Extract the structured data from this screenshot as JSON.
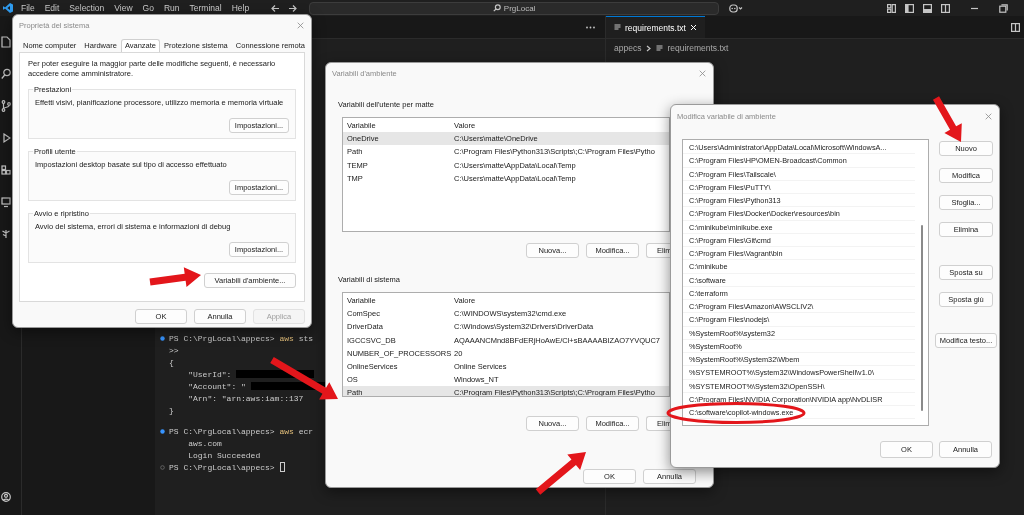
{
  "vscode": {
    "menu": [
      "File",
      "Edit",
      "Selection",
      "View",
      "Go",
      "Run",
      "Terminal",
      "Help"
    ],
    "search": {
      "value": "PrgLocal"
    },
    "editor_tab": {
      "label": "requirements.txt"
    },
    "breadcrumb": [
      "appecs",
      "requirements.txt"
    ],
    "terminal": {
      "lines": [
        {
          "kind": "prompt",
          "succeeded": true,
          "prompt": "PS C:\\PrgLocal\\appecs>",
          "command": "aws",
          "args": "sts",
          "cursor": false
        },
        {
          "kind": "output",
          "text": ">>"
        },
        {
          "kind": "output",
          "text": "{"
        },
        {
          "kind": "redacted",
          "text": "\"UserId\":"
        },
        {
          "kind": "redacted",
          "text": "\"Account\": \""
        },
        {
          "kind": "output",
          "text": "\"Arn\": \"arn:aws:iam::137"
        },
        {
          "kind": "output",
          "text": "}"
        },
        {
          "kind": "blank"
        },
        {
          "kind": "prompt",
          "succeeded": true,
          "prompt": "PS C:\\PrgLocal\\appecs>",
          "command": "aws",
          "args": "ecr",
          "cursor": false
        },
        {
          "kind": "output",
          "text": "aws.com"
        },
        {
          "kind": "output",
          "text": "Login Succeeded"
        },
        {
          "kind": "prompt",
          "succeeded": false,
          "prompt": "PS C:\\PrgLocal\\appecs>",
          "cursor": true
        }
      ]
    }
  },
  "system_properties": {
    "title": "Proprietà del sistema",
    "tabs": [
      {
        "label": "Nome computer",
        "selected": false
      },
      {
        "label": "Hardware",
        "selected": false
      },
      {
        "label": "Avanzate",
        "selected": true
      },
      {
        "label": "Protezione sistema",
        "selected": false
      },
      {
        "label": "Connessione remota",
        "selected": false
      }
    ],
    "intro": "Per poter eseguire la maggior parte delle modifiche seguenti, è necessario accedere come amministratore.",
    "groups": [
      {
        "title": "Prestazioni",
        "text": "Effetti visivi, pianificazione processore, utilizzo memoria e memoria virtuale",
        "button": "Impostazioni..."
      },
      {
        "title": "Profili utente",
        "text": "Impostazioni desktop basate sul tipo di accesso effettuato",
        "button": "Impostazioni..."
      },
      {
        "title": "Avvio e ripristino",
        "text": "Avvio del sistema, errori di sistema e informazioni di debug",
        "button": "Impostazioni..."
      }
    ],
    "env_button": "Variabili d'ambiente...",
    "buttons": [
      {
        "label": "OK",
        "disabled": false
      },
      {
        "label": "Annulla",
        "disabled": false
      },
      {
        "label": "Applica",
        "disabled": true
      }
    ]
  },
  "environment_variables": {
    "title": "Variabili d'ambiente",
    "sections": [
      {
        "title": "Variabili dell'utente per matte",
        "columns": [
          "Variabile",
          "Valore"
        ],
        "rows": [
          {
            "name": "OneDrive",
            "value": "C:\\Users\\matte\\OneDrive",
            "selected": true
          },
          {
            "name": "Path",
            "value": "C:\\Program Files\\Python313\\Scripts\\;C:\\Program Files\\Pytho",
            "selected": false
          },
          {
            "name": "TEMP",
            "value": "C:\\Users\\matte\\AppData\\Local\\Temp",
            "selected": false
          },
          {
            "name": "TMP",
            "value": "C:\\Users\\matte\\AppData\\Local\\Temp",
            "selected": false
          }
        ],
        "buttons": [
          "Nuova...",
          "Modifica...",
          "Elim"
        ]
      },
      {
        "title": "Variabili di sistema",
        "columns": [
          "Variabile",
          "Valore"
        ],
        "rows": [
          {
            "name": "ComSpec",
            "value": "C:\\WINDOWS\\system32\\cmd.exe",
            "selected": false
          },
          {
            "name": "DriverData",
            "value": "C:\\Windows\\System32\\Drivers\\DriverData",
            "selected": false
          },
          {
            "name": "IGCCSVC_DB",
            "value": "AQAAANCMnd8BFdERjHoAwE/Cl+sBAAAABIZAO7YVQUC7",
            "selected": false
          },
          {
            "name": "NUMBER_OF_PROCESSORS",
            "value": "20",
            "selected": false
          },
          {
            "name": "OnlineServices",
            "value": "Online Services",
            "selected": false
          },
          {
            "name": "OS",
            "value": "Windows_NT",
            "selected": false
          },
          {
            "name": "Path",
            "value": "C:\\Program Files\\Python313\\Scripts\\;C:\\Program Files\\Pytho",
            "selected": true
          }
        ],
        "buttons": [
          "Nuova...",
          "Modifica...",
          "Elim"
        ]
      }
    ],
    "buttons": [
      "OK",
      "Annulla"
    ]
  },
  "edit_variable": {
    "title": "Modifica variabile di ambiente",
    "items": [
      "C:\\Users\\Administrator\\AppData\\Local\\Microsoft\\WindowsA...",
      "C:\\Program Files\\HP\\OMEN-Broadcast\\Common",
      "C:\\Program Files\\Tailscale\\",
      "C:\\Program Files\\PuTTY\\",
      "C:\\Program Files\\Python313",
      "C:\\Program Files\\Docker\\Docker\\resources\\bin",
      "C:\\minikube\\minikube.exe",
      "C:\\Program Files\\Git\\cmd",
      "C:\\Program Files\\Vagrant\\bin",
      "C:\\minikube",
      "C:\\software",
      "C:\\terraform",
      "C:\\Program Files\\Amazon\\AWSCLIV2\\",
      "C:\\Program Files\\nodejs\\",
      "%SystemRoot%\\system32",
      "%SystemRoot%",
      "%SystemRoot%\\System32\\Wbem",
      "%SYSTEMROOT%\\System32\\WindowsPowerShell\\v1.0\\",
      "%SYSTEMROOT%\\System32\\OpenSSH\\",
      "C:\\Program Files\\NVIDIA Corporation\\NVIDIA app\\NvDLISR",
      "C:\\software\\copilot-windows.exe"
    ],
    "side_buttons": [
      "Nuovo",
      "Modifica",
      "Sfoglia...",
      "Elimina",
      "Sposta su",
      "Sposta giù",
      "Modifica testo..."
    ],
    "buttons": [
      "OK",
      "Annulla"
    ]
  }
}
